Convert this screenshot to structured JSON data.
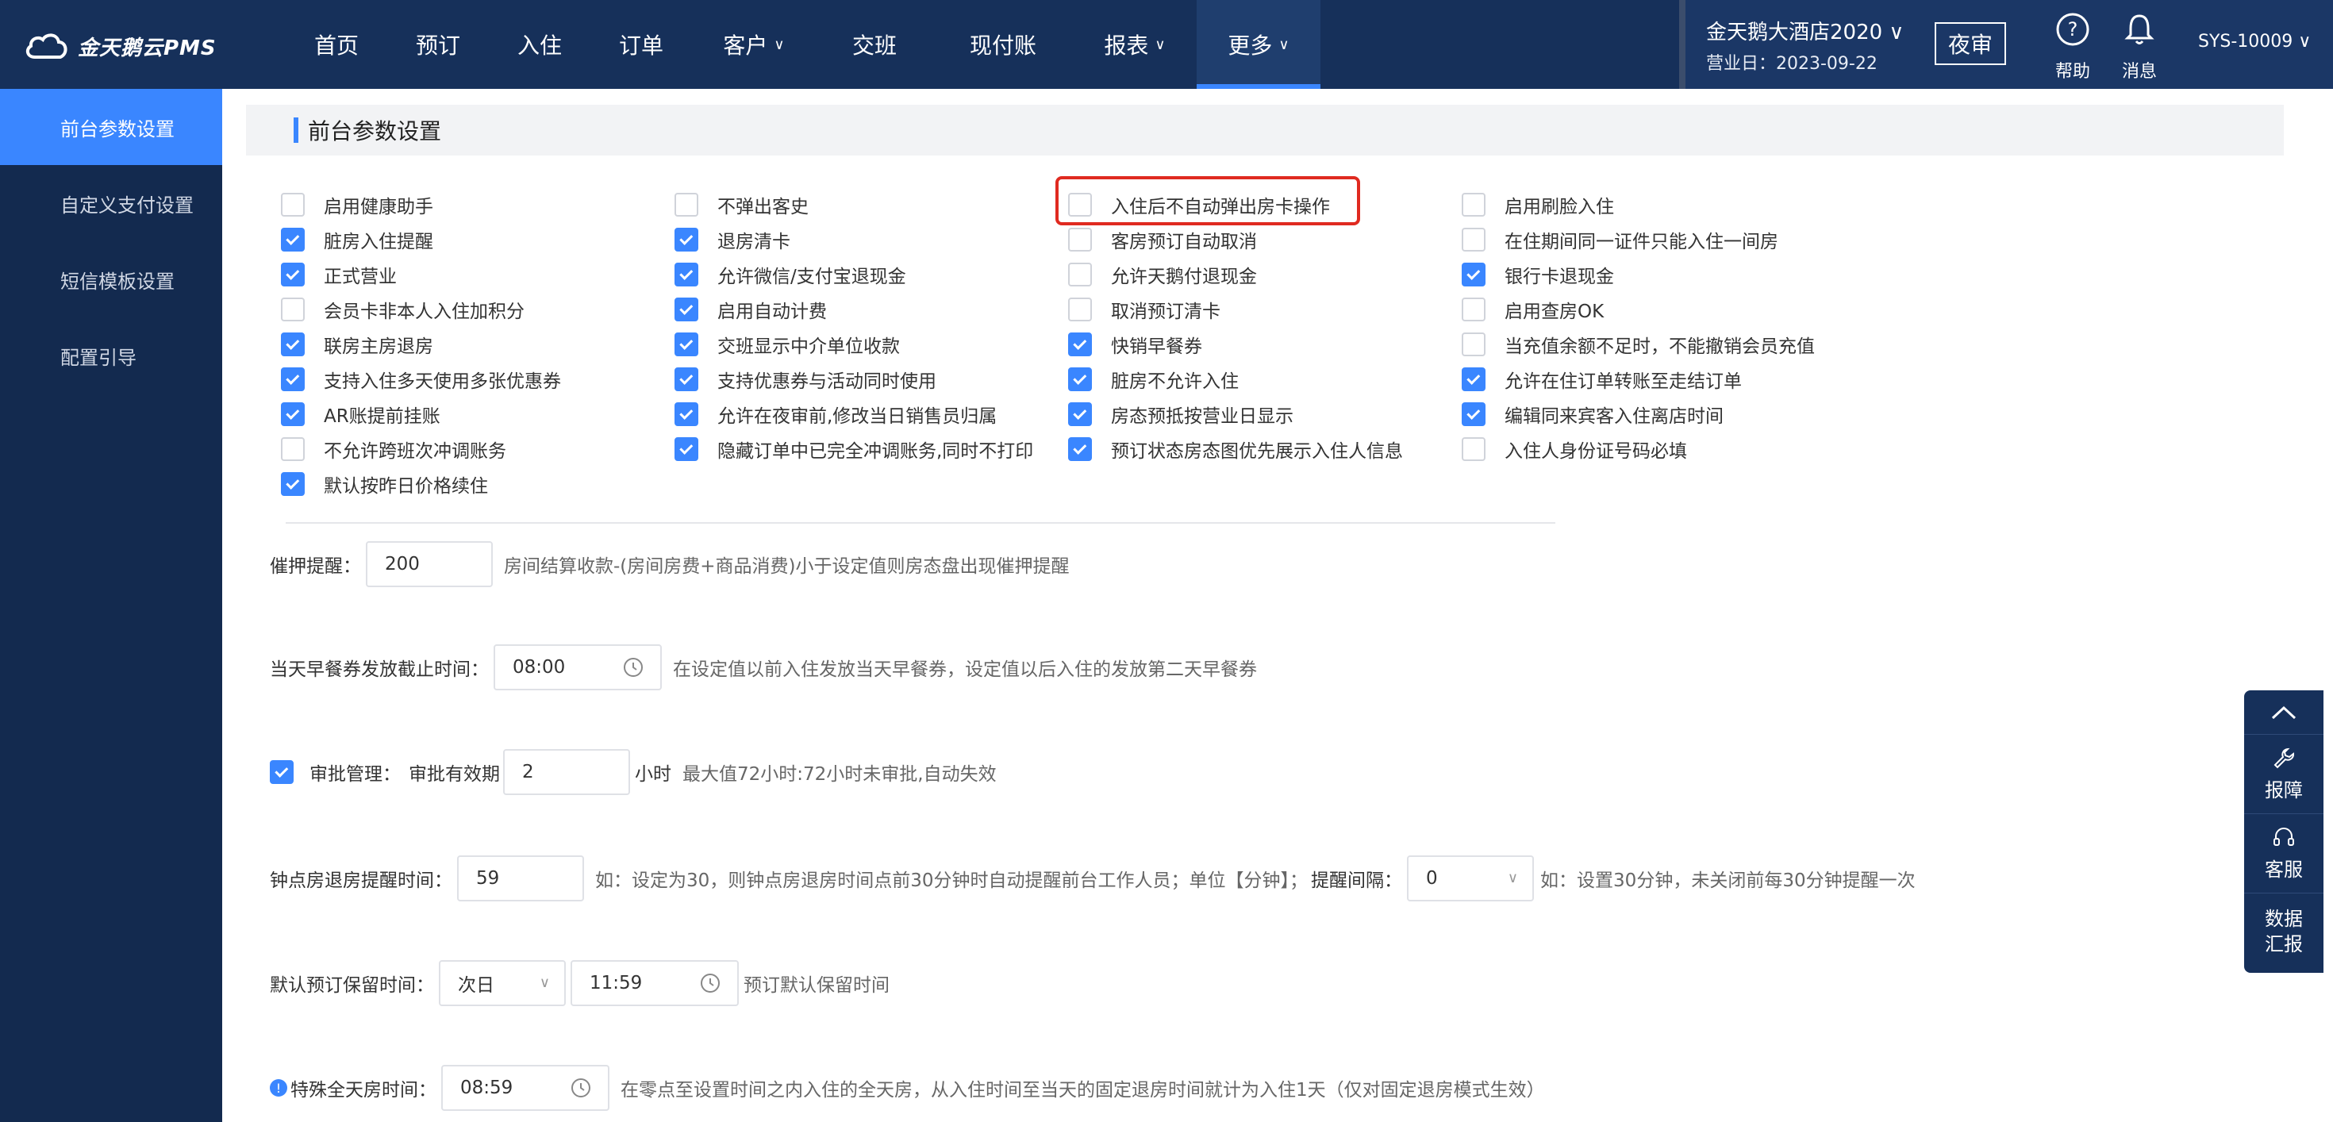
{
  "app": {
    "logo_text": "金天鹅云PMS"
  },
  "nav": [
    {
      "label": "首页",
      "chev": ""
    },
    {
      "label": "预订",
      "chev": ""
    },
    {
      "label": "入住",
      "chev": ""
    },
    {
      "label": "订单",
      "chev": ""
    },
    {
      "label": "客户",
      "chev": "∨"
    },
    {
      "label": "交班",
      "chev": ""
    },
    {
      "label": "现付账",
      "chev": ""
    },
    {
      "label": "报表",
      "chev": "∨"
    },
    {
      "label": "更多",
      "chev": "∨"
    }
  ],
  "header": {
    "hotel": "金天鹅大酒店2020 ∨",
    "business_date": "营业日：2023-09-22",
    "night_audit": "夜审",
    "help": "帮助",
    "messages": "消息",
    "user": "SYS-10009 ∨"
  },
  "sidebar": [
    {
      "label": "前台参数设置"
    },
    {
      "label": "自定义支付设置"
    },
    {
      "label": "短信模板设置"
    },
    {
      "label": "配置引导"
    }
  ],
  "section": {
    "title": "前台参数设置"
  },
  "checkboxes": {
    "col1": [
      {
        "label": "启用健康助手",
        "checked": false
      },
      {
        "label": "脏房入住提醒",
        "checked": true
      },
      {
        "label": "正式营业",
        "checked": true
      },
      {
        "label": "会员卡非本人入住加积分",
        "checked": false
      },
      {
        "label": "联房主房退房",
        "checked": true
      },
      {
        "label": "支持入住多天使用多张优惠券",
        "checked": true
      },
      {
        "label": "AR账提前挂账",
        "checked": true
      },
      {
        "label": "不允许跨班次冲调账务",
        "checked": false
      },
      {
        "label": "默认按昨日价格续住",
        "checked": true
      }
    ],
    "col2": [
      {
        "label": "不弹出客史",
        "checked": false
      },
      {
        "label": "退房清卡",
        "checked": true
      },
      {
        "label": "允许微信/支付宝退现金",
        "checked": true
      },
      {
        "label": "启用自动计费",
        "checked": true
      },
      {
        "label": "交班显示中介单位收款",
        "checked": true
      },
      {
        "label": "支持优惠券与活动同时使用",
        "checked": true
      },
      {
        "label": "允许在夜审前,修改当日销售员归属",
        "checked": true
      },
      {
        "label": "隐藏订单中已完全冲调账务,同时不打印",
        "checked": true
      }
    ],
    "col3": [
      {
        "label": "入住后不自动弹出房卡操作",
        "checked": false
      },
      {
        "label": "客房预订自动取消",
        "checked": false
      },
      {
        "label": "允许天鹅付退现金",
        "checked": false
      },
      {
        "label": "取消预订清卡",
        "checked": false
      },
      {
        "label": "快销早餐券",
        "checked": true
      },
      {
        "label": "脏房不允许入住",
        "checked": true
      },
      {
        "label": "房态预抵按营业日显示",
        "checked": true
      },
      {
        "label": "预订状态房态图优先展示入住人信息",
        "checked": true
      }
    ],
    "col4": [
      {
        "label": "启用刷脸入住",
        "checked": false
      },
      {
        "label": "在住期间同一证件只能入住一间房",
        "checked": false
      },
      {
        "label": "银行卡退现金",
        "checked": true
      },
      {
        "label": "启用查房OK",
        "checked": false
      },
      {
        "label": "当充值余额不足时，不能撤销会员充值",
        "checked": false
      },
      {
        "label": "允许在住订单转账至走结订单",
        "checked": true
      },
      {
        "label": "编辑同来宾客入住离店时间",
        "checked": true
      },
      {
        "label": "入住人身份证号码必填",
        "checked": false
      }
    ]
  },
  "settings": {
    "deposit_label": "催押提醒：",
    "deposit_value": "200",
    "deposit_hint": "房间结算收款-(房间房费+商品消费)小于设定值则房态盘出现催押提醒",
    "breakfast_label": "当天早餐券发放截止时间：",
    "breakfast_value": "08:00",
    "breakfast_hint": "在设定值以前入住发放当天早餐券，设定值以后入住的发放第二天早餐券",
    "approval_label": "审批管理：",
    "approval_valid_label": "审批有效期",
    "approval_value": "2",
    "approval_unit": "小时",
    "approval_hint": "最大值72小时:72小时未审批,自动失效",
    "approval_checked": true,
    "hourly_label": "钟点房退房提醒时间：",
    "hourly_value": "59",
    "hourly_hint": "如：设定为30，则钟点房退房时间点前30分钟时自动提醒前台工作人员；单位【分钟】；",
    "interval_label": "提醒间隔：",
    "interval_value": "0",
    "interval_hint": "如：设置30分钟，未关闭前每30分钟提醒一次",
    "reserve_label": "默认预订保留时间：",
    "reserve_day": "次日",
    "reserve_time": "11:59",
    "reserve_hint": "预订默认保留时间",
    "fullday_label": "特殊全天房时间：",
    "fullday_value": "08:59",
    "fullday_hint": "在零点至设置时间之内入住的全天房，从入住时间至当天的固定退房时间就计为入住1天（仅对固定退房模式生效）"
  },
  "float_panel": {
    "report": "报障",
    "service": "客服",
    "data": "数据汇报"
  },
  "colors": {
    "primary": "#3a86ff",
    "header_bg": "#16305a",
    "sidebar_bg": "#132a4f",
    "highlight": "#e02a20"
  }
}
